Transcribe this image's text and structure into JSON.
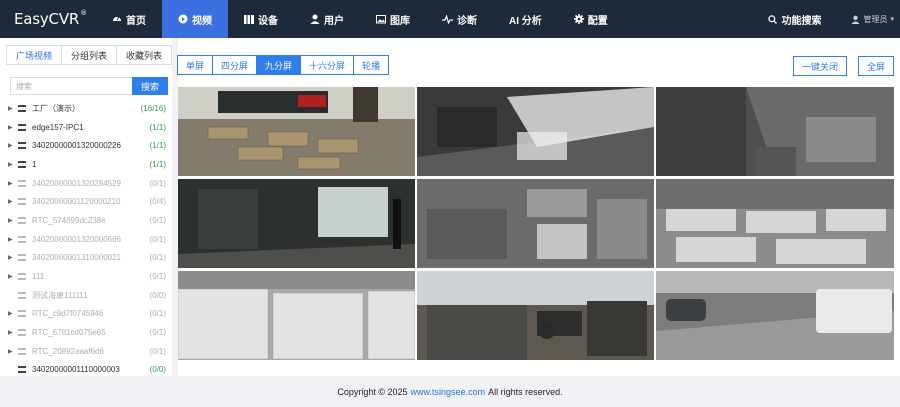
{
  "app": {
    "logo": "EasyCVR",
    "logo_mark": "®"
  },
  "nav": {
    "items": [
      {
        "label": "首页",
        "icon": "dashboard-icon",
        "active": false
      },
      {
        "label": "视频",
        "icon": "play-circle-icon",
        "active": true
      },
      {
        "label": "设备",
        "icon": "server-icon",
        "active": false
      },
      {
        "label": "用户",
        "icon": "user-icon",
        "active": false
      },
      {
        "label": "图库",
        "icon": "gallery-icon",
        "active": false
      },
      {
        "label": "诊断",
        "icon": "pulse-icon",
        "active": false
      },
      {
        "label": "AI 分析",
        "icon": "",
        "active": false
      },
      {
        "label": "配置",
        "icon": "gear-icon",
        "active": false
      }
    ],
    "function_search": "功能搜索",
    "user_name": "管理员"
  },
  "sidebar": {
    "tabs": [
      "广场视频",
      "分组列表",
      "收藏列表"
    ],
    "active_tab": 0,
    "search_placeholder": "搜索",
    "search_button": "搜索",
    "tree": [
      {
        "name": "工厂（演示）",
        "count": "(16/16)",
        "online": true,
        "expandable": true
      },
      {
        "name": "edge157-IPC1",
        "count": "(1/1)",
        "online": true,
        "expandable": true
      },
      {
        "name": "34020000001320000226",
        "count": "(1/1)",
        "online": true,
        "expandable": true
      },
      {
        "name": "1",
        "count": "(1/1)",
        "online": true,
        "expandable": true
      },
      {
        "name": "34020000001320284529",
        "count": "(0/1)",
        "online": false,
        "expandable": true
      },
      {
        "name": "34020000001120000210",
        "count": "(0/4)",
        "online": false,
        "expandable": true
      },
      {
        "name": "RTC_574699dc238e",
        "count": "(0/1)",
        "online": false,
        "expandable": true
      },
      {
        "name": "34020000001320000666",
        "count": "(0/1)",
        "online": false,
        "expandable": true
      },
      {
        "name": "34020000001310000021",
        "count": "(0/1)",
        "online": false,
        "expandable": true
      },
      {
        "name": "111",
        "count": "(0/1)",
        "online": false,
        "expandable": true
      },
      {
        "name": "测试海康111111",
        "count": "(0/0)",
        "online": false,
        "expandable": false
      },
      {
        "name": "RTC_c9d7f0745946",
        "count": "(0/1)",
        "online": false,
        "expandable": true
      },
      {
        "name": "RTC_6781cd075e65",
        "count": "(0/1)",
        "online": false,
        "expandable": true
      },
      {
        "name": "RTC_20892aaaf6d6",
        "count": "(0/1)",
        "online": false,
        "expandable": true
      },
      {
        "name": "34020000001110000003",
        "count": "(0/0)",
        "online": true,
        "expandable": false
      }
    ]
  },
  "toolbar": {
    "layouts": [
      "单屏",
      "四分屏",
      "九分屏",
      "十六分屏",
      "轮播"
    ],
    "active_layout": 2,
    "stop_all": "一键关闭",
    "fullscreen": "全屏"
  },
  "grid": {
    "selected": 0,
    "cells": [
      {
        "scene": "warehouse-floor",
        "bg": "#6b6a63"
      },
      {
        "scene": "dark-hall",
        "bg": "#4a4a4a"
      },
      {
        "scene": "grey-room",
        "bg": "#5a5a5a"
      },
      {
        "scene": "factory-door",
        "bg": "#3d4140"
      },
      {
        "scene": "night-storage",
        "bg": "#6d6d6d"
      },
      {
        "scene": "bright-warehouse",
        "bg": "#9a9a9a"
      },
      {
        "scene": "pallet-stacks",
        "bg": "#b9b9b9"
      },
      {
        "scene": "office",
        "bg": "#5e5a55"
      },
      {
        "scene": "parking-lot",
        "bg": "#8e8e8e"
      }
    ]
  },
  "footer": {
    "prefix": "Copyright © 2025",
    "link": "www.tsingsee.com",
    "suffix": "All rights reserved."
  }
}
